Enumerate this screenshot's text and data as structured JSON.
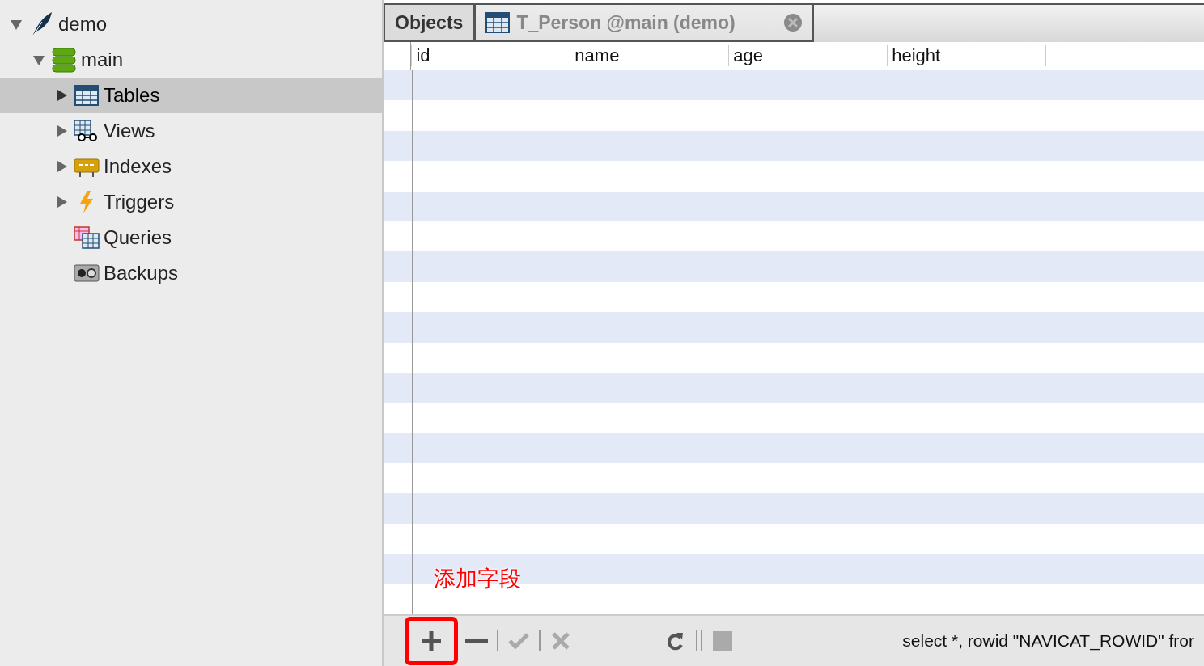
{
  "sidebar": {
    "tree": [
      {
        "label": "demo",
        "kind": "connection",
        "expanded": true,
        "selected": false,
        "children": [
          {
            "label": "main",
            "kind": "database",
            "expanded": true,
            "selected": false,
            "children": [
              {
                "label": "Tables",
                "kind": "tables",
                "expanded": false,
                "selected": true
              },
              {
                "label": "Views",
                "kind": "views",
                "expanded": false,
                "selected": false
              },
              {
                "label": "Indexes",
                "kind": "indexes",
                "expanded": false,
                "selected": false
              },
              {
                "label": "Triggers",
                "kind": "triggers",
                "expanded": false,
                "selected": false
              },
              {
                "label": "Queries",
                "kind": "queries",
                "selected": false
              },
              {
                "label": "Backups",
                "kind": "backups",
                "selected": false
              }
            ]
          }
        ]
      }
    ]
  },
  "tabs": [
    {
      "label": "Objects",
      "selected": false,
      "closable": false
    },
    {
      "label": "T_Person @main (demo)",
      "selected": true,
      "closable": true
    }
  ],
  "table": {
    "columns": [
      "id",
      "name",
      "age",
      "height"
    ]
  },
  "callout": {
    "text": "添加字段"
  },
  "toolbar": {
    "buttons": [
      {
        "kind": "add",
        "disabled": false,
        "highlighted": true
      },
      {
        "kind": "remove",
        "disabled": false,
        "highlighted": false
      },
      {
        "kind": "apply",
        "disabled": true,
        "highlighted": false
      },
      {
        "kind": "discard",
        "disabled": true,
        "highlighted": false
      },
      {
        "kind": "refresh",
        "disabled": false,
        "highlighted": false
      },
      {
        "kind": "stop",
        "disabled": true,
        "highlighted": false
      }
    ],
    "status": "select *, rowid \"NAVICAT_ROWID\" fror"
  }
}
